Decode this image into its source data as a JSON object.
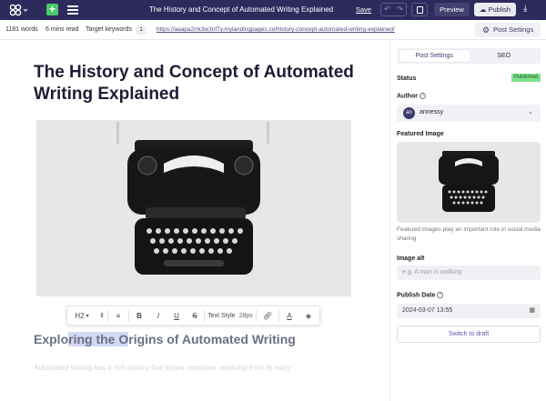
{
  "topbar": {
    "title": "The History and Concept of Automated Writing Explained",
    "save_label": "Save",
    "preview_label": "Preview",
    "publish_label": "Publish"
  },
  "subbar": {
    "words": "1181 words",
    "read_time": "6 mins read",
    "target_keywords_label": "Target keywords",
    "target_keywords_count": "1",
    "url": "https://aaapa2rrk3w3nf7y.mylandingpages.co/history-concept-automated-writing-explained/",
    "post_settings_label": "Post Settings"
  },
  "editor": {
    "title": "The History and Concept of Automated Writing Explained",
    "toolbar": {
      "heading_label": "H2",
      "text_style_label": "Text Style",
      "font_size": "28px"
    },
    "subheading_before": "Explo",
    "subheading_highlight": "ring the O",
    "subheading_after": "rigins of Automated Writing",
    "paragraph": "Automated writing has a rich history that spans centuries, evolving from its early"
  },
  "sidebar": {
    "tabs": [
      "Post Settings",
      "SEO"
    ],
    "status_label": "Status",
    "status_value": "Published",
    "author_label": "Author",
    "author_initials": "an",
    "author_name": "annessy",
    "featured_image_label": "Featured Image",
    "featured_help": "Featured images play an important role in social media sharing",
    "image_alt_label": "Image alt",
    "image_alt_placeholder": "e.g. A man is walking",
    "publish_date_label": "Publish Date",
    "publish_date_value": "2024-03-07 13:55",
    "switch_draft_label": "Switch to draft"
  },
  "colors": {
    "topbar": "#2d2a5c",
    "accent": "#3d3a70",
    "published": "#7ee08a",
    "plus": "#4cc96a"
  },
  "icons": [
    "logo-icon",
    "plus-icon",
    "menu-icon",
    "undo-icon",
    "redo-icon",
    "device-icon",
    "publish-cloud-icon",
    "download-icon",
    "gear-icon",
    "info-icon",
    "chevron-down-icon",
    "calendar-icon",
    "bold-icon",
    "italic-icon",
    "underline-icon",
    "strikethrough-icon",
    "link-icon",
    "text-color-icon",
    "fill-icon",
    "align-icon"
  ]
}
